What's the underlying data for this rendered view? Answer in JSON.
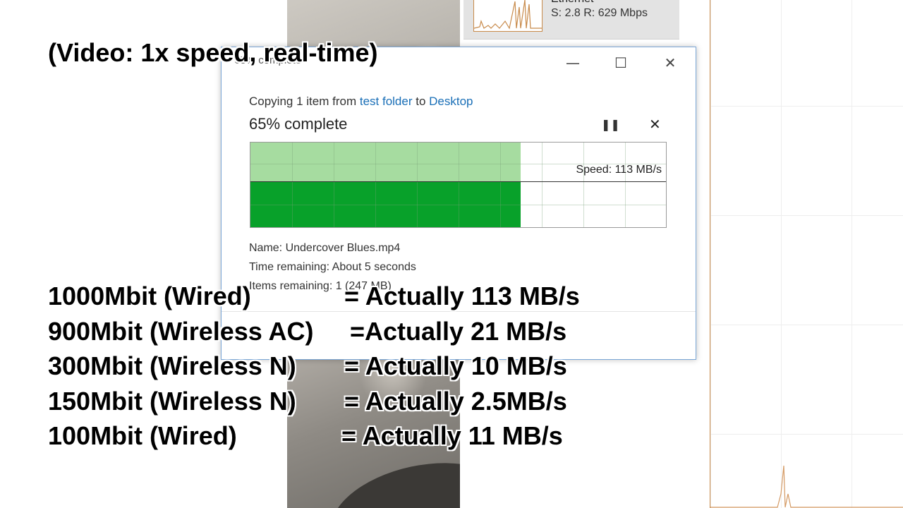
{
  "background": {
    "ethernet_label": "Ethernet",
    "ethernet_stats": "S: 2.8  R: 629 Mbps"
  },
  "dialog": {
    "title": "65% complete",
    "copy_prefix": "Copying 1 item from ",
    "source": "test folder",
    "copy_mid": " to ",
    "destination": "Desktop",
    "percent_text": "65% complete",
    "progress_percent": 65,
    "speed_text": "Speed: 113 MB/s",
    "name_line": "Name:  Undercover Blues.mp4",
    "time_line": "Time remaining:  About 5 seconds",
    "items_line": "Items remaining:  1 (247 MB)",
    "colors": {
      "progress_light": "#a6dca0",
      "progress_dark": "#08a12a",
      "link": "#1a6fb7"
    }
  },
  "overlay": {
    "header": "(Video: 1x speed, real-time)",
    "rows": [
      {
        "left": "1000Mbit (Wired)",
        "right": "= Actually 113 MB/s"
      },
      {
        "left": "900Mbit (Wireless AC)",
        "right": "=Actually 21 MB/s"
      },
      {
        "left": "300Mbit (Wireless N)",
        "right": "= Actually 10 MB/s"
      },
      {
        "left": "150Mbit (Wireless N)",
        "right": "= Actually 2.5MB/s"
      },
      {
        "left": "100Mbit (Wired)",
        "right": "= Actually 11 MB/s"
      }
    ]
  }
}
